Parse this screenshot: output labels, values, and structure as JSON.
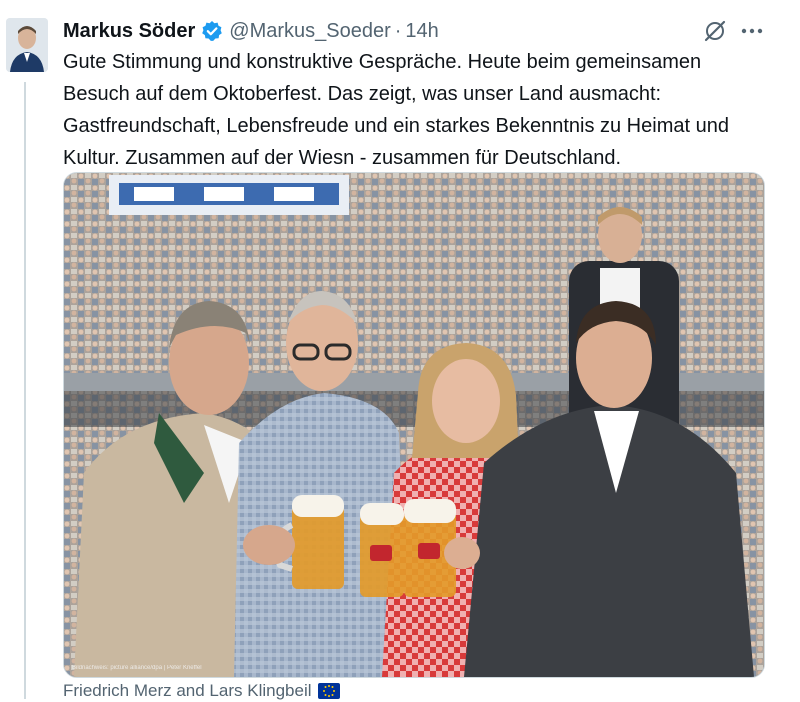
{
  "author": {
    "name": "Markus Söder",
    "handle": "@Markus_Soeder",
    "separator": "·",
    "time": "14h"
  },
  "icons": {
    "verified": "verified-badge-icon",
    "grok": "grok-icon",
    "more": "more-icon",
    "eu_flag": "eu-flag-icon"
  },
  "tweet": {
    "lines": [
      "Gute Stimmung und konstruktive Gespräche. Heute beim gemeinsamen",
      "Besuch auf dem Oktoberfest. Das zeigt, was unser Land ausmacht:",
      "Gastfreundschaft, Lebensfreude und ein starkes Bekenntnis zu Heimat und",
      "Kultur. Zusammen auf der Wiesn - zusammen für Deutschland."
    ]
  },
  "media": {
    "credit": "Bildnachweis: picture alliance/dpa | Peter Kneffel"
  },
  "caption": {
    "text": "Friedrich Merz and Lars Klingbeil"
  },
  "colors": {
    "verified_blue": "#1d9bf0",
    "secondary_text": "#536471",
    "eu_blue": "#003399",
    "eu_gold": "#ffcc00"
  }
}
